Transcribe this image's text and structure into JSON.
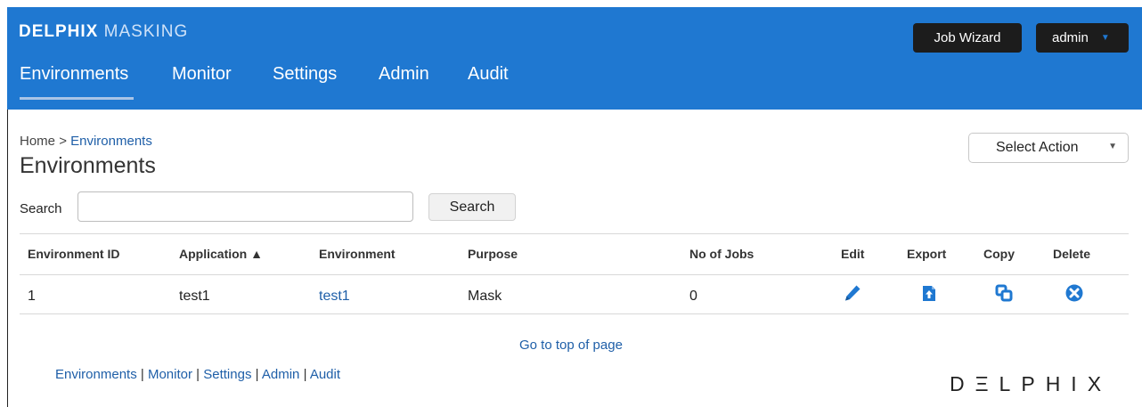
{
  "header": {
    "brand_bold": "DELPHIX",
    "brand_light": "MASKING",
    "job_wizard_label": "Job Wizard",
    "user_label": "admin",
    "nav": [
      {
        "label": "Environments",
        "active": true
      },
      {
        "label": "Monitor"
      },
      {
        "label": "Settings"
      },
      {
        "label": "Admin"
      },
      {
        "label": "Audit"
      }
    ]
  },
  "breadcrumb": {
    "home": "Home",
    "separator": ">",
    "current": "Environments"
  },
  "page_title": "Environments",
  "select_action": {
    "label": "Select Action"
  },
  "search": {
    "label": "Search",
    "value": "",
    "button_label": "Search"
  },
  "table": {
    "headers": [
      "Environment ID",
      "Application ▲",
      "Environment",
      "Purpose",
      "No of Jobs",
      "Edit",
      "Export",
      "Copy",
      "Delete"
    ],
    "rows": [
      {
        "environment_id": "1",
        "application": "test1",
        "environment": "test1",
        "purpose": "Mask",
        "no_of_jobs": "0"
      }
    ]
  },
  "footer": {
    "go_to_top": "Go to top of page",
    "links": [
      "Environments",
      "Monitor",
      "Settings",
      "Admin",
      "Audit"
    ],
    "separator": "|",
    "logo_text": "DΞLPHIX"
  },
  "icons": {
    "edit": "pencil-icon",
    "export": "export-icon",
    "copy": "copy-icon",
    "delete": "delete-x-icon"
  },
  "colors": {
    "header_bg": "#1f78d1",
    "link": "#1f5fa8",
    "dark_button": "#1c1c1c"
  }
}
